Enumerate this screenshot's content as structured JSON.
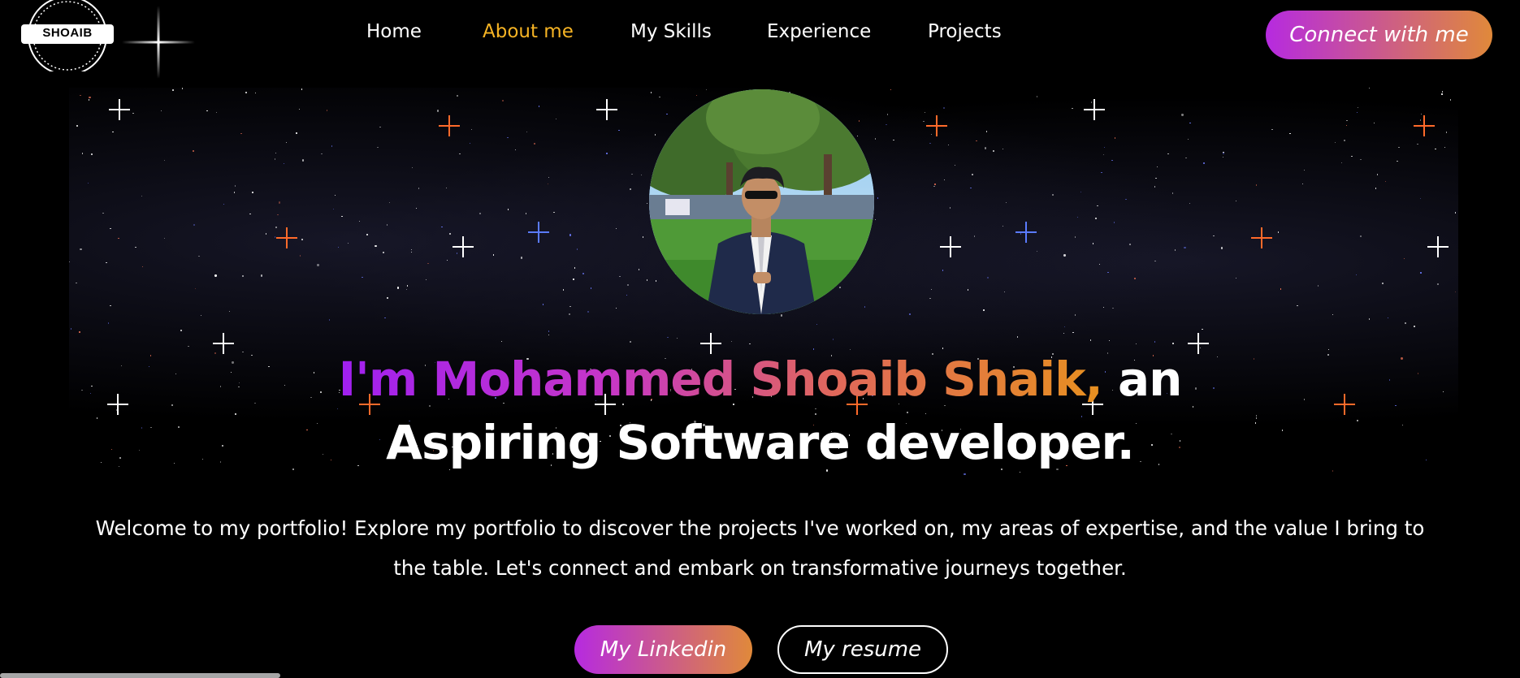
{
  "logo": {
    "text": "SHOAIB"
  },
  "nav": {
    "items": [
      {
        "label": "Home",
        "active": false
      },
      {
        "label": "About me",
        "active": true
      },
      {
        "label": "My Skills",
        "active": false
      },
      {
        "label": "Experience",
        "active": false
      },
      {
        "label": "Projects",
        "active": false
      }
    ],
    "connect_label": "Connect with me"
  },
  "hero": {
    "name_prefix": "I'm Mohammed Shoaib Shaik,",
    "name_suffix": " an",
    "line2": "Aspiring Software developer.",
    "intro": "Welcome to my portfolio! Explore my portfolio to discover the projects I've worked on, my areas of expertise, and the value I bring to the table. Let's connect and embark on transformative journeys together.",
    "linkedin_label": "My Linkedin",
    "resume_label": "My resume"
  },
  "colors": {
    "background": "#000000",
    "accent_active": "#f5b324",
    "gradient_start": "#b62ae0",
    "gradient_end": "#e0893a"
  },
  "icons": {
    "logo": "circular-badge-logo",
    "avatar": "profile-photo"
  }
}
